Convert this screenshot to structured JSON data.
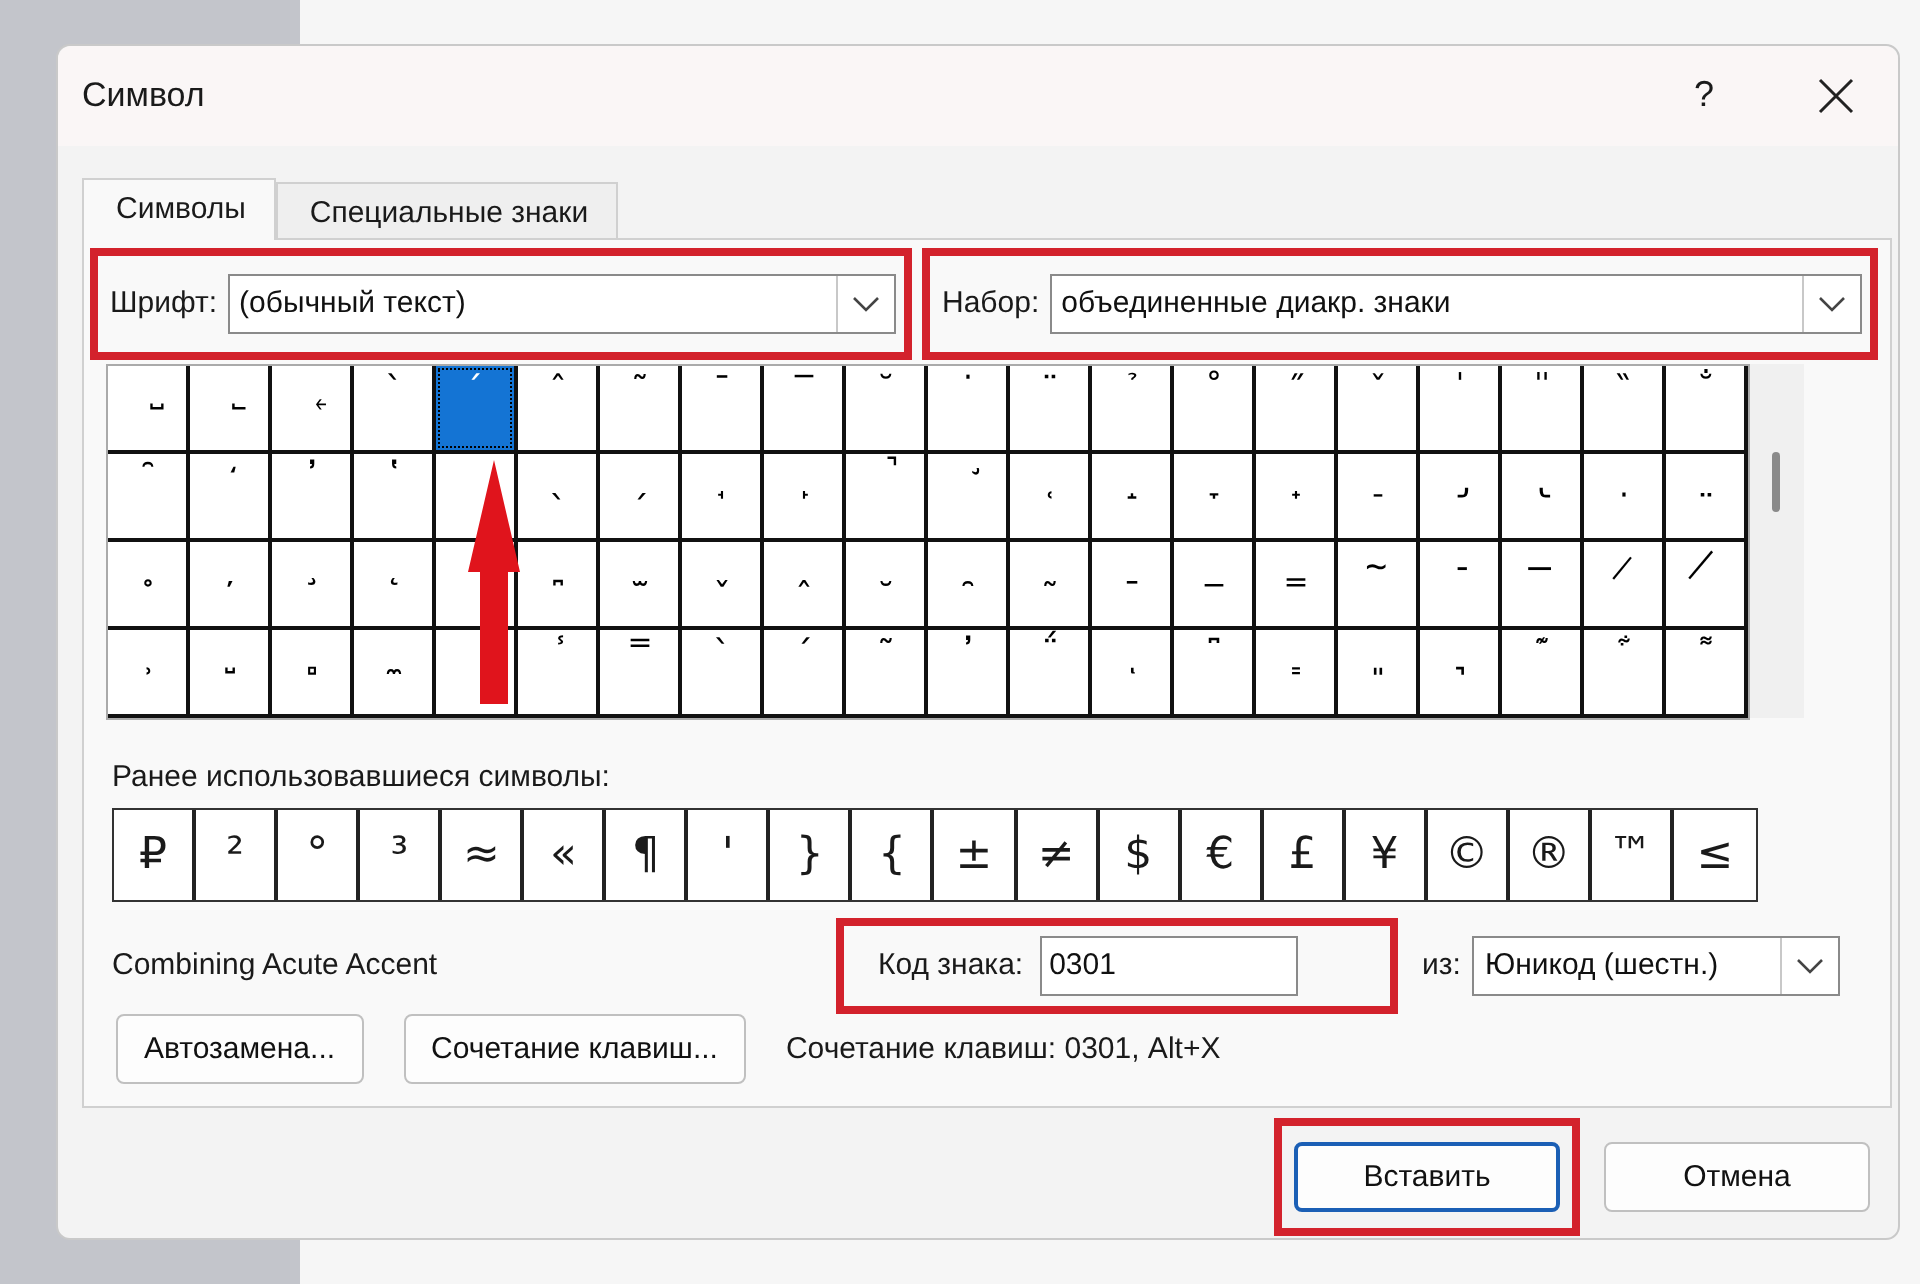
{
  "window": {
    "title": "Символ",
    "help": "?"
  },
  "tabs": [
    {
      "label": "Символы",
      "selected": true
    },
    {
      "label": "Специальные знаки",
      "selected": false
    }
  ],
  "font": {
    "label": "Шрифт:",
    "value": "(обычный текст)",
    "highlighted": true
  },
  "subset": {
    "label": "Набор:",
    "value": "объединенные диакр. знаки",
    "highlighted": true
  },
  "symbol_grid": {
    "cells": [
      {
        "kind": "symbol",
        "char": "˽",
        "selected": false
      },
      {
        "kind": "symbol",
        "char": "˾",
        "selected": false
      },
      {
        "kind": "symbol",
        "char": "˿",
        "selected": false
      },
      {
        "kind": "symbol",
        "char": "̀",
        "selected": false
      },
      {
        "kind": "symbol",
        "char": "́",
        "selected": true
      },
      {
        "kind": "symbol",
        "char": "̂",
        "selected": false
      },
      {
        "kind": "symbol",
        "char": "̃",
        "selected": false
      },
      {
        "kind": "symbol",
        "char": "̄",
        "selected": false
      },
      {
        "kind": "symbol",
        "char": "̅",
        "selected": false
      },
      {
        "kind": "symbol",
        "char": "̆",
        "selected": false
      },
      {
        "kind": "symbol",
        "char": "̇",
        "selected": false
      },
      {
        "kind": "symbol",
        "char": "̈",
        "selected": false
      },
      {
        "kind": "symbol",
        "char": "̉",
        "selected": false
      },
      {
        "kind": "symbol",
        "char": "̊",
        "selected": false
      },
      {
        "kind": "symbol",
        "char": "̋",
        "selected": false
      },
      {
        "kind": "symbol",
        "char": "̌",
        "selected": false
      },
      {
        "kind": "symbol",
        "char": "̍",
        "selected": false
      },
      {
        "kind": "symbol",
        "char": "̎",
        "selected": false
      },
      {
        "kind": "symbol",
        "char": "̏",
        "selected": false
      },
      {
        "kind": "symbol",
        "char": "̐",
        "selected": false
      },
      {
        "kind": "symbol",
        "char": "̑",
        "selected": false
      },
      {
        "kind": "symbol",
        "char": "̒",
        "selected": false
      },
      {
        "kind": "symbol",
        "char": "̓",
        "selected": false
      },
      {
        "kind": "symbol",
        "char": "̔",
        "selected": false
      },
      {
        "kind": "covered"
      },
      {
        "kind": "symbol",
        "char": "̖",
        "selected": false
      },
      {
        "kind": "symbol",
        "char": "̗",
        "selected": false
      },
      {
        "kind": "symbol",
        "char": "̘",
        "selected": false
      },
      {
        "kind": "symbol",
        "char": "̙",
        "selected": false
      },
      {
        "kind": "symbol",
        "char": "̚",
        "selected": false
      },
      {
        "kind": "symbol",
        "char": "̛",
        "selected": false
      },
      {
        "kind": "symbol",
        "char": "̜",
        "selected": false
      },
      {
        "kind": "symbol",
        "char": "̝",
        "selected": false
      },
      {
        "kind": "symbol",
        "char": "̞",
        "selected": false
      },
      {
        "kind": "symbol",
        "char": "̟",
        "selected": false
      },
      {
        "kind": "symbol",
        "char": "̠",
        "selected": false
      },
      {
        "kind": "symbol",
        "char": "̡",
        "selected": false
      },
      {
        "kind": "symbol",
        "char": "̢",
        "selected": false
      },
      {
        "kind": "symbol",
        "char": "̣",
        "selected": false
      },
      {
        "kind": "symbol",
        "char": "̤",
        "selected": false
      },
      {
        "kind": "symbol",
        "char": "̥",
        "selected": false
      },
      {
        "kind": "symbol",
        "char": "̦",
        "selected": false
      },
      {
        "kind": "symbol",
        "char": "̧",
        "selected": false
      },
      {
        "kind": "symbol",
        "char": "̨",
        "selected": false
      },
      {
        "kind": "covered"
      },
      {
        "kind": "symbol",
        "char": "̪",
        "selected": false
      },
      {
        "kind": "symbol",
        "char": "̫",
        "selected": false
      },
      {
        "kind": "symbol",
        "char": "̬",
        "selected": false
      },
      {
        "kind": "symbol",
        "char": "̭",
        "selected": false
      },
      {
        "kind": "symbol",
        "char": "̮",
        "selected": false
      },
      {
        "kind": "symbol",
        "char": "̯",
        "selected": false
      },
      {
        "kind": "symbol",
        "char": "̰",
        "selected": false
      },
      {
        "kind": "symbol",
        "char": "̱",
        "selected": false
      },
      {
        "kind": "symbol",
        "char": "̲",
        "selected": false
      },
      {
        "kind": "symbol",
        "char": "̳",
        "selected": false
      },
      {
        "kind": "symbol",
        "char": "̴",
        "selected": false
      },
      {
        "kind": "symbol",
        "char": "̵",
        "selected": false
      },
      {
        "kind": "symbol",
        "char": "̶",
        "selected": false
      },
      {
        "kind": "symbol",
        "char": "̷",
        "selected": false
      },
      {
        "kind": "symbol",
        "char": "̸",
        "selected": false
      },
      {
        "kind": "symbol",
        "char": "̹",
        "selected": false
      },
      {
        "kind": "symbol",
        "char": "̺",
        "selected": false
      },
      {
        "kind": "symbol",
        "char": "̻",
        "selected": false
      },
      {
        "kind": "symbol",
        "char": "̼",
        "selected": false
      },
      {
        "kind": "covered"
      },
      {
        "kind": "symbol",
        "char": "̾",
        "selected": false
      },
      {
        "kind": "symbol",
        "char": "̿",
        "selected": false
      },
      {
        "kind": "symbol",
        "char": "̀",
        "selected": false
      },
      {
        "kind": "symbol",
        "char": "́",
        "selected": false
      },
      {
        "kind": "symbol",
        "char": "͂",
        "selected": false
      },
      {
        "kind": "symbol",
        "char": "̓",
        "selected": false
      },
      {
        "kind": "symbol",
        "char": "̈́",
        "selected": false
      },
      {
        "kind": "symbol",
        "char": "ͅ",
        "selected": false
      },
      {
        "kind": "symbol",
        "char": "͆",
        "selected": false
      },
      {
        "kind": "symbol",
        "char": "͇",
        "selected": false
      },
      {
        "kind": "symbol",
        "char": "͈",
        "selected": false
      },
      {
        "kind": "symbol",
        "char": "͉",
        "selected": false
      },
      {
        "kind": "symbol",
        "char": "͊",
        "selected": false
      },
      {
        "kind": "symbol",
        "char": "͋",
        "selected": false
      },
      {
        "kind": "symbol",
        "char": "͌",
        "selected": false
      }
    ]
  },
  "recent_label": "Ранее использовавшиеся символы:",
  "recent": [
    "₽",
    "²",
    "°",
    "³",
    "≈",
    "«",
    "¶",
    "'",
    "}",
    "{",
    "±",
    "≠",
    "$",
    "€",
    "£",
    "¥",
    "©",
    "®",
    "™",
    "≤"
  ],
  "character_name": "Combining Acute Accent",
  "char_code": {
    "label": "Код знака:",
    "value": "0301",
    "highlighted": true
  },
  "from": {
    "label": "из:",
    "value": "Юникод (шестн.)"
  },
  "buttons": [
    {
      "label": "Автозамена..."
    },
    {
      "label": "Сочетание клавиш..."
    }
  ],
  "shortcut_text": "Сочетание клавиш: 0301, Alt+X",
  "footer_buttons": [
    {
      "label": "Вставить",
      "default": true,
      "highlighted": true
    },
    {
      "label": "Отмена",
      "default": false,
      "highlighted": false
    }
  ]
}
